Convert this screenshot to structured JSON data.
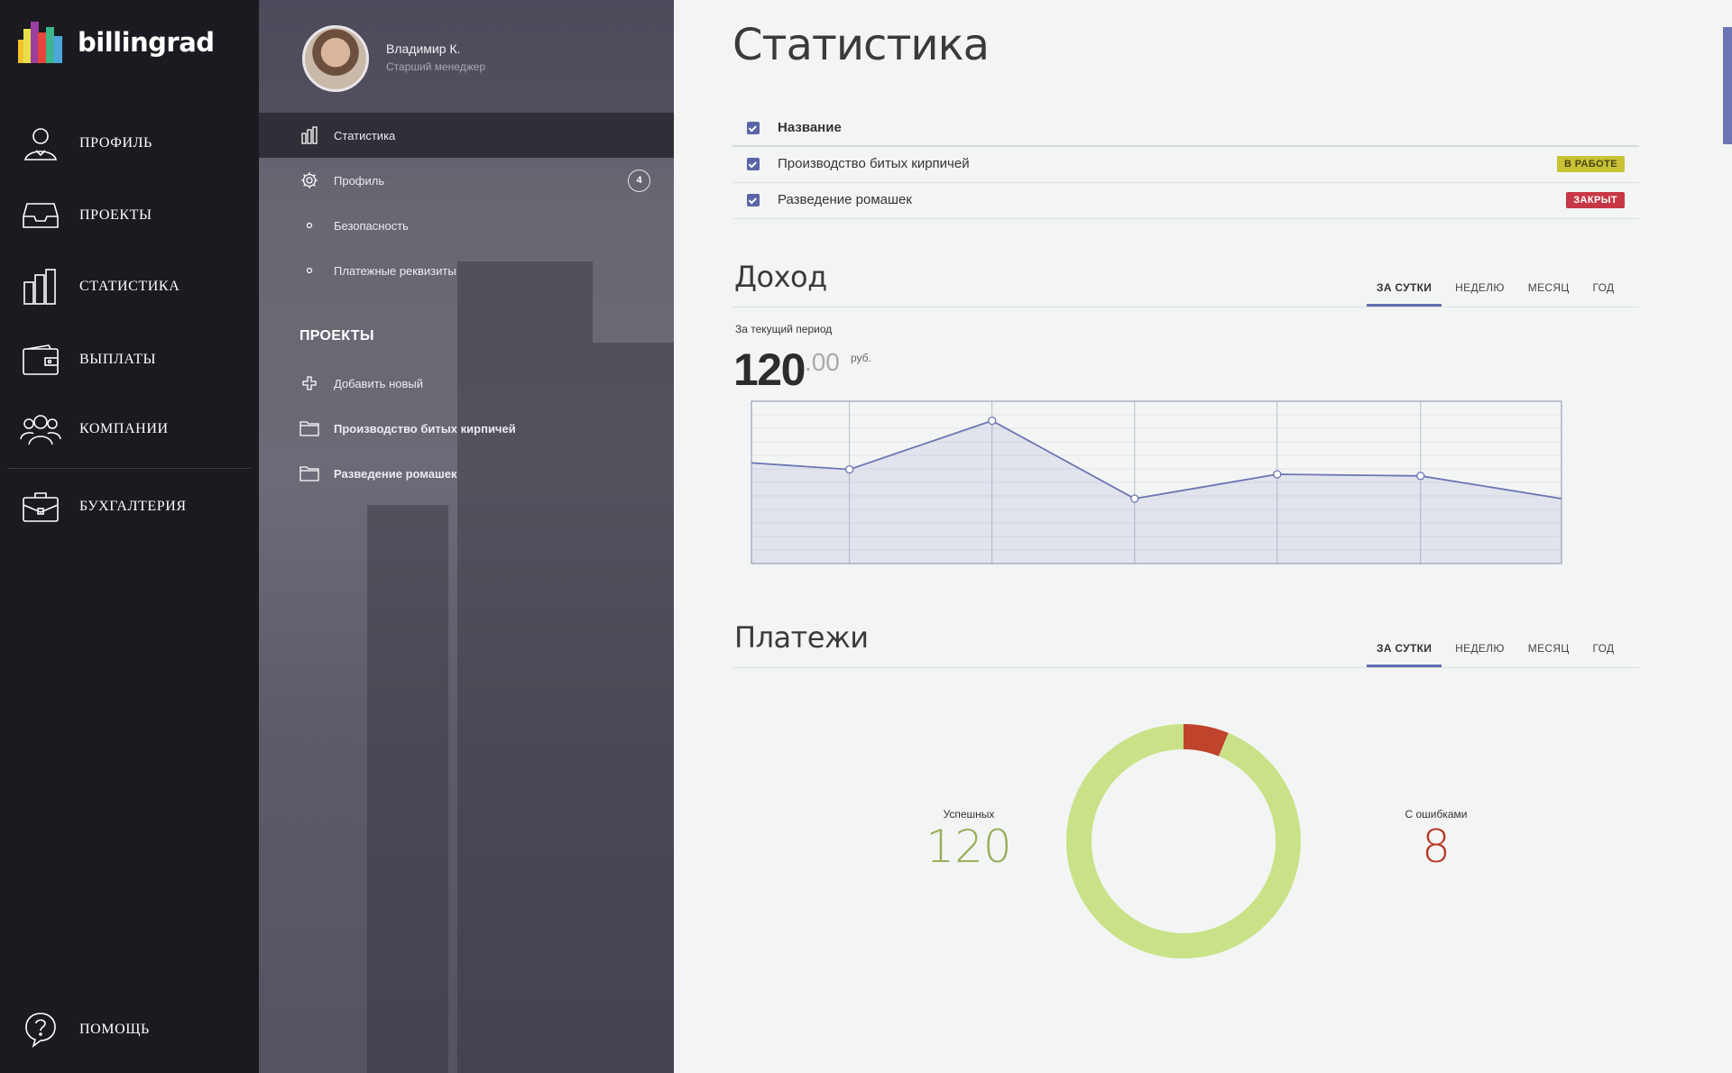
{
  "app": {
    "logo_text": "billingrad"
  },
  "nav": {
    "items": [
      {
        "label": "ПРОФИЛЬ",
        "icon": "user-icon"
      },
      {
        "label": "ПРОЕКТЫ",
        "icon": "inbox-icon"
      },
      {
        "label": "СТАТИСТИКА",
        "icon": "bar-chart-icon"
      },
      {
        "label": "ВЫПЛАТЫ",
        "icon": "wallet-icon"
      },
      {
        "label": "КОМПАНИИ",
        "icon": "group-icon"
      },
      {
        "label": "БУХГАЛТЕРИЯ",
        "icon": "briefcase-icon"
      }
    ],
    "help": {
      "label": "ПОМОЩЬ",
      "icon": "help-icon"
    }
  },
  "user": {
    "name": "Владимир К.",
    "role": "Старший менеджер"
  },
  "subnav": {
    "items": [
      {
        "label": "Статистика",
        "icon": "bar-chart-icon",
        "active": true
      },
      {
        "label": "Профиль",
        "icon": "gear-icon",
        "badge": "4"
      },
      {
        "label": "Безопасность",
        "icon": "dot-icon"
      },
      {
        "label": "Платежные реквизиты",
        "icon": "dot-icon"
      }
    ],
    "projects_heading": "ПРОЕКТЫ",
    "projects": [
      {
        "label": "Добавить новый",
        "icon": "plus-icon"
      },
      {
        "label": "Производство битых кирпичей",
        "icon": "folder-icon"
      },
      {
        "label": "Разведение ромашек",
        "icon": "folder-icon"
      }
    ]
  },
  "main": {
    "title": "Статистика",
    "table": {
      "header": "Название",
      "rows": [
        {
          "name": "Производство битых кирпичей",
          "status": "В РАБОТЕ",
          "status_color": "#c8c234"
        },
        {
          "name": "Разведение ромашек",
          "status": "ЗАКРЫТ",
          "status_color": "#c83745"
        }
      ]
    },
    "income": {
      "title": "Доход",
      "tabs": [
        "ЗА СУТКИ",
        "НЕДЕЛЮ",
        "МЕСЯЦ",
        "ГОД"
      ],
      "active_tab": "ЗА СУТКИ",
      "period_label": "За текущий период",
      "value_int": "120",
      "value_dec": ".00",
      "currency": "руб."
    },
    "payments": {
      "title": "Платежи",
      "tabs": [
        "ЗА СУТКИ",
        "НЕДЕЛЮ",
        "МЕСЯЦ",
        "ГОД"
      ],
      "active_tab": "ЗА СУТКИ",
      "success_label": "Успешных",
      "success_value": "120",
      "error_label": "С ошибками",
      "error_value": "8"
    }
  },
  "colors": {
    "accent": "#5f6db2",
    "success": "#c9e288",
    "error": "#c0432c",
    "success_text": "#9aae5a",
    "error_text": "#b83a28"
  },
  "chart_data": [
    {
      "type": "area",
      "title": "",
      "x": [
        0,
        1,
        2,
        3,
        4,
        5,
        6,
        7
      ],
      "series": [
        {
          "values": [
            0.62,
            0.58,
            0.88,
            0.4,
            0.55,
            0.54,
            0.4
          ]
        }
      ],
      "xlabel": "",
      "ylabel": "",
      "grid": true
    },
    {
      "type": "pie",
      "labels": [
        "Успешных",
        "С ошибками"
      ],
      "values": [
        120,
        8
      ],
      "donut": true
    }
  ]
}
